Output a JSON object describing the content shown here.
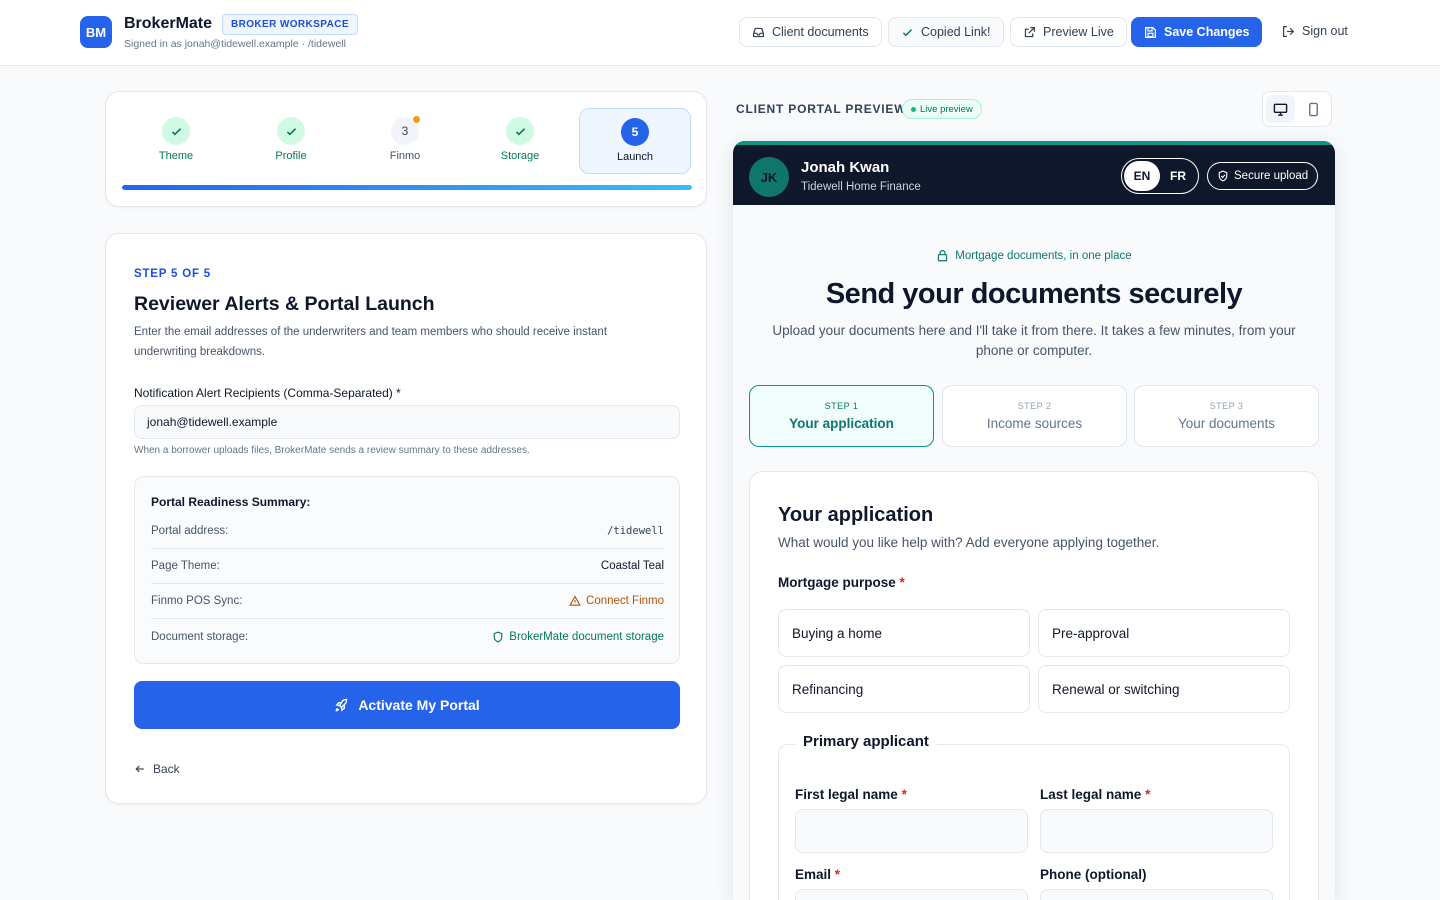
{
  "header": {
    "logo": "BM",
    "brand": "BrokerMate",
    "workspace_badge": "BROKER WORKSPACE",
    "signed_in": "Signed in as jonah@tidewell.example · /tidewell",
    "buttons": {
      "client_documents": "Client documents",
      "copied_link": "Copied Link!",
      "preview_live": "Preview Live",
      "save_changes": "Save Changes",
      "sign_out": "Sign out"
    }
  },
  "stepper": {
    "steps": [
      {
        "label": "Theme",
        "state": "done",
        "marker": ""
      },
      {
        "label": "Profile",
        "state": "done",
        "marker": ""
      },
      {
        "label": "Finmo",
        "state": "pending",
        "marker": "3"
      },
      {
        "label": "Storage",
        "state": "done",
        "marker": ""
      },
      {
        "label": "Launch",
        "state": "current",
        "marker": "5"
      }
    ],
    "progress": 1.0
  },
  "form": {
    "eyebrow": "STEP 5 OF 5",
    "title": "Reviewer Alerts & Portal Launch",
    "description": "Enter the email addresses of the underwriters and team members who should receive instant underwriting breakdowns.",
    "recipients_label": "Notification Alert Recipients (Comma-Separated) *",
    "recipients_value": "jonah@tidewell.example",
    "recipients_help": "When a borrower uploads files, BrokerMate sends a review summary to these addresses.",
    "summary": {
      "title": "Portal Readiness Summary:",
      "rows": [
        {
          "key": "Portal address:",
          "value": "/tidewell"
        },
        {
          "key": "Page Theme:",
          "value": "Coastal Teal"
        },
        {
          "key": "Finmo POS Sync:",
          "value": "Connect Finmo"
        },
        {
          "key": "Document storage:",
          "value": "BrokerMate document storage"
        }
      ]
    },
    "activate_label": "Activate My Portal",
    "back_label": "Back"
  },
  "preview": {
    "label": "CLIENT PORTAL PREVIEW",
    "badge": "Live preview",
    "portal": {
      "initials": "JK",
      "name": "Jonah Kwan",
      "company": "Tidewell Home Finance",
      "lang_en": "EN",
      "lang_fr": "FR",
      "secure_upload": "Secure upload",
      "tagline": "Mortgage documents, in one place",
      "hero": "Send your documents securely",
      "subhero": "Upload your documents here and I'll take it from there. It takes a few minutes, from your phone or computer.",
      "tabs": [
        {
          "step": "STEP 1",
          "title": "Your application"
        },
        {
          "step": "STEP 2",
          "title": "Income sources"
        },
        {
          "step": "STEP 3",
          "title": "Your documents"
        }
      ],
      "application": {
        "title": "Your application",
        "subtitle": "What would you like help with? Add everyone applying together.",
        "purpose_label": "Mortgage purpose",
        "options": [
          "Buying a home",
          "Pre-approval",
          "Refinancing",
          "Renewal or switching"
        ],
        "applicant_legend": "Primary applicant",
        "first_name_label": "First legal name",
        "last_name_label": "Last legal name",
        "email_label": "Email",
        "phone_label": "Phone (optional)",
        "required_mark": "*"
      }
    }
  },
  "colors": {
    "accent": "#2563eb",
    "teal": "#0d9488",
    "success": "#047857",
    "warning": "#b45309",
    "portal_header": "#0f172a"
  }
}
